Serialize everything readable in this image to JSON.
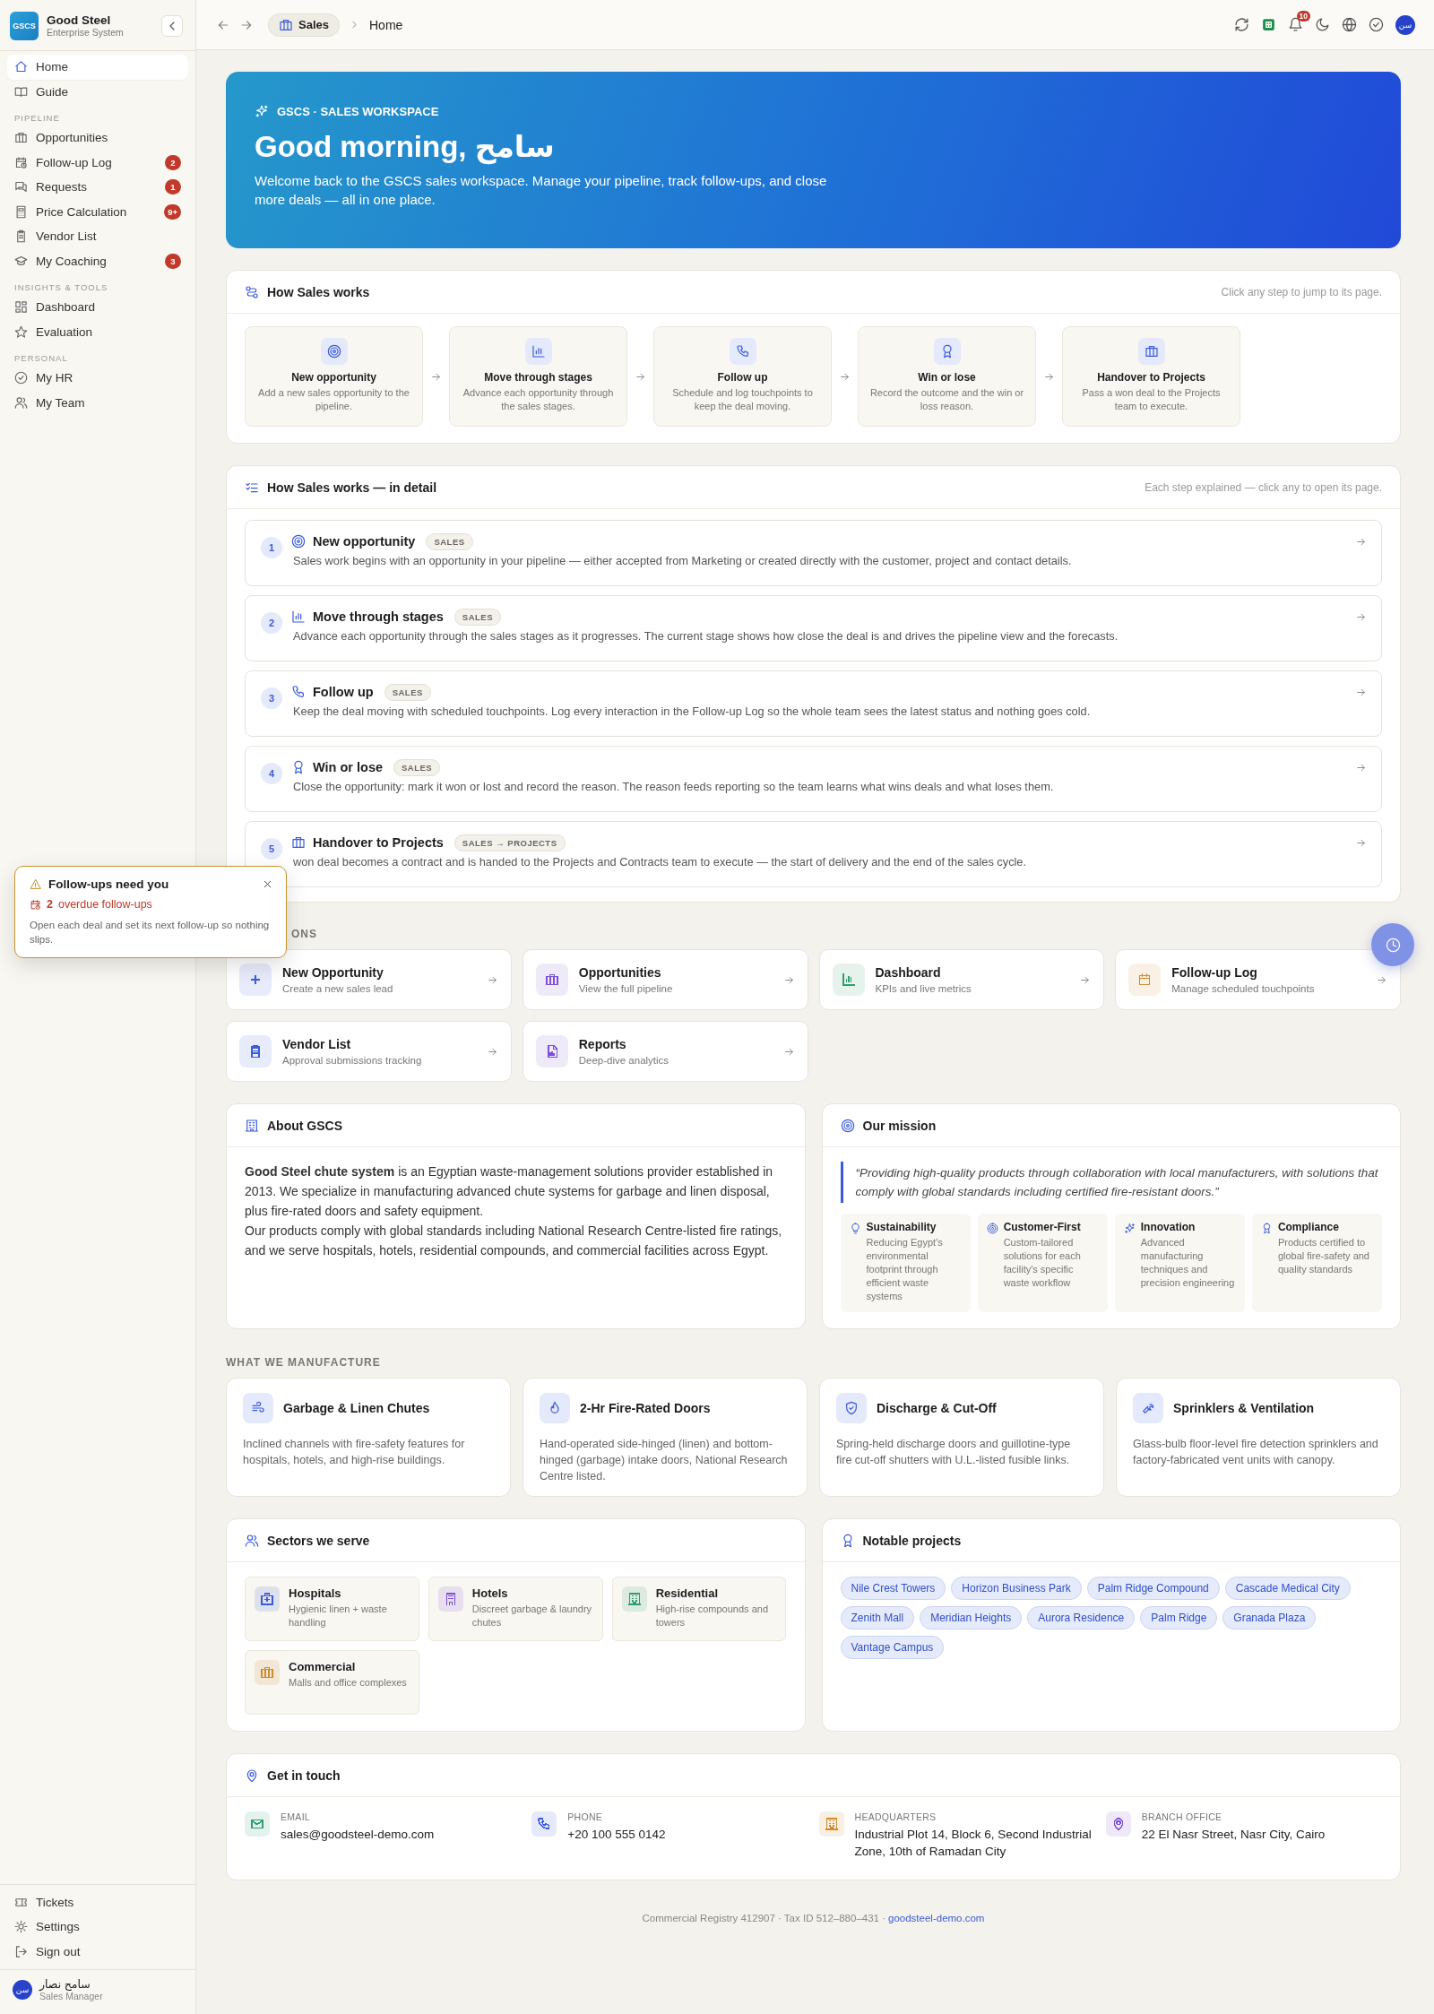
{
  "sidebar": {
    "brand": {
      "logo": "GSCS",
      "name": "Good Steel",
      "subtitle": "Enterprise System"
    },
    "top_items": [
      {
        "label": "Home",
        "selected": true
      },
      {
        "label": "Guide",
        "selected": false
      }
    ],
    "sections": [
      {
        "title": "PIPELINE",
        "items": [
          {
            "label": "Opportunities",
            "selected": false
          },
          {
            "label": "Follow-up Log",
            "badge": "2",
            "selected": false
          },
          {
            "label": "Requests",
            "badge": "1",
            "selected": false
          },
          {
            "label": "Price Calculation",
            "badge": "9+",
            "selected": false
          },
          {
            "label": "Vendor List",
            "selected": false
          },
          {
            "label": "My Coaching",
            "badge": "3",
            "selected": false
          }
        ]
      },
      {
        "title": "INSIGHTS & TOOLS",
        "items": [
          {
            "label": "Dashboard",
            "selected": false
          },
          {
            "label": "Evaluation",
            "selected": false
          }
        ]
      },
      {
        "title": "PERSONAL",
        "items": [
          {
            "label": "My HR",
            "selected": false
          },
          {
            "label": "My Team",
            "selected": false
          }
        ]
      }
    ],
    "bottom_items": [
      {
        "label": "Tickets"
      },
      {
        "label": "Settings"
      },
      {
        "label": "Sign out"
      }
    ],
    "user": {
      "avatar": "سن",
      "name": "سامح نصار",
      "role": "Sales Manager"
    }
  },
  "topbar": {
    "section": "Sales",
    "page": "Home",
    "notifications": "10",
    "avatar": "سن"
  },
  "hero": {
    "eyebrow": "GSCS · SALES WORKSPACE",
    "greeting": "Good morning, سامح",
    "text": "Welcome back to the GSCS sales workspace. Manage your pipeline, track follow-ups, and close more deals — all in one place."
  },
  "how_it_works": {
    "title": "How Sales works",
    "hint": "Click any step to jump to its page.",
    "steps": [
      {
        "title": "New opportunity",
        "text": "Add a new sales opportunity to the pipeline."
      },
      {
        "title": "Move through stages",
        "text": "Advance each opportunity through the sales stages."
      },
      {
        "title": "Follow up",
        "text": "Schedule and log touchpoints to keep the deal moving."
      },
      {
        "title": "Win or lose",
        "text": "Record the outcome and the win or loss reason."
      },
      {
        "title": "Handover to Projects",
        "text": "Pass a won deal to the Projects team to execute."
      }
    ]
  },
  "detail": {
    "title": "How Sales works — in detail",
    "hint": "Each step explained — click any to open its page.",
    "steps": [
      {
        "number": "1",
        "title": "New opportunity",
        "tag": "SALES",
        "text": "Sales work begins with an opportunity in your pipeline — either accepted from Marketing or created directly with the customer, project and contact details."
      },
      {
        "number": "2",
        "title": "Move through stages",
        "tag": "SALES",
        "text": "Advance each opportunity through the sales stages as it progresses. The current stage shows how close the deal is and drives the pipeline view and the forecasts."
      },
      {
        "number": "3",
        "title": "Follow up",
        "tag": "SALES",
        "text": "Keep the deal moving with scheduled touchpoints. Log every interaction in the Follow-up Log so the whole team sees the latest status and nothing goes cold."
      },
      {
        "number": "4",
        "title": "Win or lose",
        "tag": "SALES",
        "text": "Close the opportunity: mark it won or lost and record the reason. The reason feeds reporting so the team learns what wins deals and what loses them."
      },
      {
        "number": "5",
        "title": "Handover to Projects",
        "tag": "SALES → PROJECTS",
        "text": "won deal becomes a contract and is handed to the Projects and Contracts team to execute — the start of delivery and the end of the sales cycle."
      }
    ]
  },
  "toast": {
    "title": "Follow-ups need you",
    "count": "2",
    "label": "overdue follow-ups",
    "text": "Open each deal and set its next follow-up so nothing slips."
  },
  "quick_actions": {
    "heading": "ONS",
    "items": [
      {
        "title": "New Opportunity",
        "text": "Create a new sales lead",
        "color": "#3b5bdb"
      },
      {
        "title": "Opportunities",
        "text": "View the full pipeline",
        "color": "#7c4fd6"
      },
      {
        "title": "Dashboard",
        "text": "KPIs and live metrics",
        "color": "#2f9e6e"
      },
      {
        "title": "Follow-up Log",
        "text": "Manage scheduled touchpoints",
        "color": "#d08a2a"
      },
      {
        "title": "Vendor List",
        "text": "Approval submissions tracking",
        "color": "#3b5bdb"
      },
      {
        "title": "Reports",
        "text": "Deep-dive analytics",
        "color": "#7c4fd6"
      }
    ]
  },
  "about": {
    "title": "About GSCS",
    "paragraphs": [
      "**Good Steel chute system** is an Egyptian waste-management solutions provider established in 2013. We specialize in manufacturing advanced chute systems for garbage and linen disposal, plus fire-rated doors and safety equipment.",
      "Our products comply with global standards including National Research Centre-listed fire ratings, and we serve hospitals, hotels, residential compounds, and commercial facilities across Egypt."
    ]
  },
  "mission": {
    "title": "Our mission",
    "quote": "“Providing high-quality products through collaboration with local manufacturers, with solutions that comply with global standards including certified fire-resistant doors.”",
    "values": [
      {
        "title": "Sustainability",
        "text": "Reducing Egypt's environmental footprint through efficient waste systems"
      },
      {
        "title": "Customer-First",
        "text": "Custom-tailored solutions for each facility's specific waste workflow"
      },
      {
        "title": "Innovation",
        "text": "Advanced manufacturing techniques and precision engineering"
      },
      {
        "title": "Compliance",
        "text": "Products certified to global fire-safety and quality standards"
      }
    ]
  },
  "manufacture": {
    "heading": "WHAT WE MANUFACTURE",
    "items": [
      {
        "title": "Garbage & Linen Chutes",
        "text": "Inclined channels with fire-safety features for hospitals, hotels, and high-rise buildings."
      },
      {
        "title": "2-Hr Fire-Rated Doors",
        "text": "Hand-operated side-hinged (linen) and bottom-hinged (garbage) intake doors, National Research Centre listed."
      },
      {
        "title": "Discharge & Cut-Off",
        "text": "Spring-held discharge doors and guillotine-type fire cut-off shutters with U.L.-listed fusible links."
      },
      {
        "title": "Sprinklers & Ventilation",
        "text": "Glass-bulb floor-level fire detection sprinklers and factory-fabricated vent units with canopy."
      }
    ]
  },
  "sectors": {
    "title": "Sectors we serve",
    "items": [
      {
        "title": "Hospitals",
        "text": "Hygienic linen + waste handling",
        "color": "#3b5bdb"
      },
      {
        "title": "Hotels",
        "text": "Discreet garbage & laundry chutes",
        "color": "#7c4fd6"
      },
      {
        "title": "Residential",
        "text": "High-rise compounds and towers",
        "color": "#2f9e6e"
      },
      {
        "title": "Commercial",
        "text": "Malls and office complexes",
        "color": "#d08a2a"
      }
    ]
  },
  "projects": {
    "title": "Notable projects",
    "tags": [
      "Nile Crest Towers",
      "Horizon Business Park",
      "Palm Ridge Compound",
      "Cascade Medical City",
      "Zenith Mall",
      "Meridian Heights",
      "Aurora Residence",
      "Palm Ridge",
      "Granada Plaza",
      "Vantage Campus"
    ]
  },
  "contact": {
    "title": "Get in touch",
    "items": [
      {
        "label": "EMAIL",
        "value": "sales@goodsteel-demo.com",
        "color": "#2f9e6e"
      },
      {
        "label": "PHONE",
        "value": "+20 100 555 0142",
        "color": "#3b5bdb"
      },
      {
        "label": "HEADQUARTERS",
        "value": "Industrial Plot 14, Block 6, Second Industrial Zone, 10th of Ramadan City",
        "color": "#d08a2a"
      },
      {
        "label": "BRANCH OFFICE",
        "value": "22 El Nasr Street, Nasr City, Cairo",
        "color": "#7c4fd6"
      }
    ]
  },
  "footer": {
    "text": "Commercial Registry 412907 · Tax ID 512–880–431 ·",
    "link": "goodsteel-demo.com"
  }
}
